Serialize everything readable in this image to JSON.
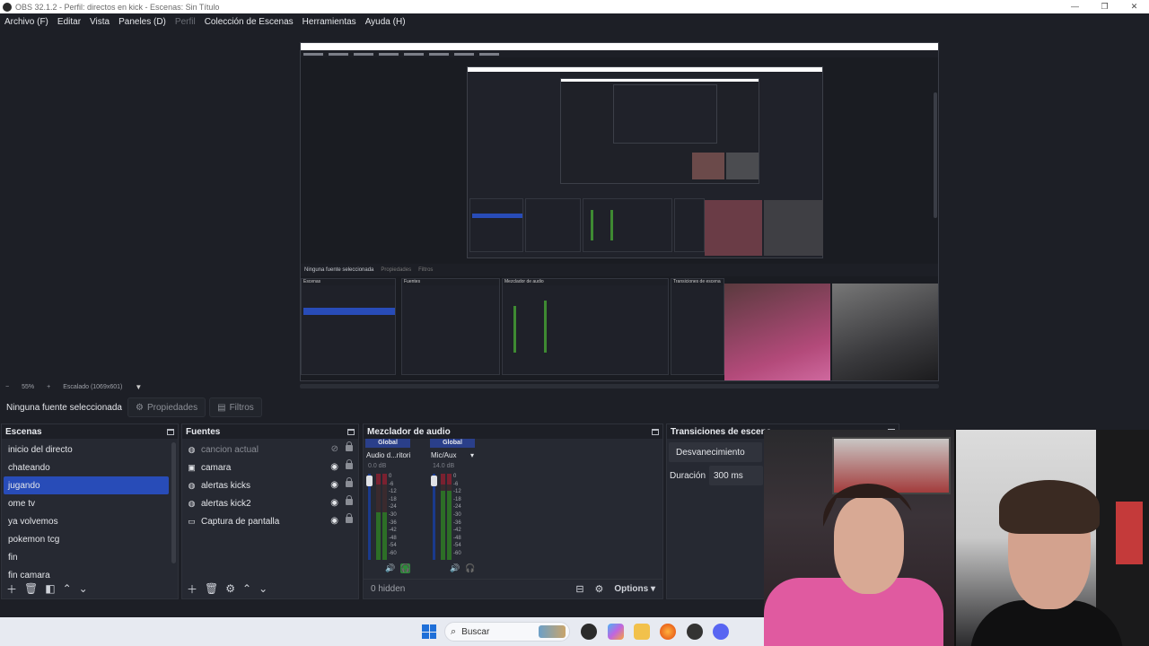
{
  "window": {
    "title": "OBS 32.1.2 - Perfil: directos en kick - Escenas: Sin Título"
  },
  "menu": [
    "Archivo (F)",
    "Editar",
    "Vista",
    "Paneles (D)",
    "Perfil",
    "Colección de Escenas",
    "Herramientas",
    "Ayuda (H)"
  ],
  "zoom": {
    "minus": "−",
    "value": "55%",
    "plus": "+",
    "mode": "Escalado (1069x601)"
  },
  "props_bar": {
    "no_selection": "Ninguna fuente seleccionada",
    "properties": "Propiedades",
    "filters": "Filtros"
  },
  "scenes": {
    "title": "Escenas",
    "items": [
      "inicio del directo",
      "chateando",
      "jugando",
      "ome tv",
      "ya volvemos",
      "pokemon tcg",
      "fin",
      "fin camara"
    ],
    "selected_index": 2
  },
  "sources": {
    "title": "Fuentes",
    "items": [
      {
        "label": "cancion actual",
        "icon": "globe-icon",
        "hidden": true
      },
      {
        "label": "camara",
        "icon": "camera-icon",
        "hidden": false
      },
      {
        "label": "alertas kicks",
        "icon": "globe-icon",
        "hidden": false
      },
      {
        "label": "alertas kick2",
        "icon": "globe-icon",
        "hidden": false
      },
      {
        "label": "Captura de pantalla",
        "icon": "monitor-icon",
        "hidden": false
      }
    ]
  },
  "mixer": {
    "title": "Mezclador de audio",
    "channels": [
      {
        "tag": "Global",
        "name": "Audio d...ritorio",
        "db": "0.0 dB",
        "level": 0.55
      },
      {
        "tag": "Global",
        "name": "Mic/Aux",
        "db": "14.0 dB",
        "level": 0.8
      }
    ],
    "ticks": [
      "0",
      "-6",
      "-12",
      "-18",
      "-24",
      "-30",
      "-36",
      "-42",
      "-48",
      "-54",
      "-60"
    ],
    "hidden_label": "0 hidden",
    "options_label": "Options"
  },
  "transitions": {
    "title": "Transiciones de escena",
    "current": "Desvanecimiento",
    "duration_label": "Duración",
    "duration_value": "300 ms"
  },
  "taskbar": {
    "search_placeholder": "Buscar"
  },
  "colors": {
    "accent": "#284cb8",
    "background": "#1d1f26",
    "panel": "#262932"
  }
}
